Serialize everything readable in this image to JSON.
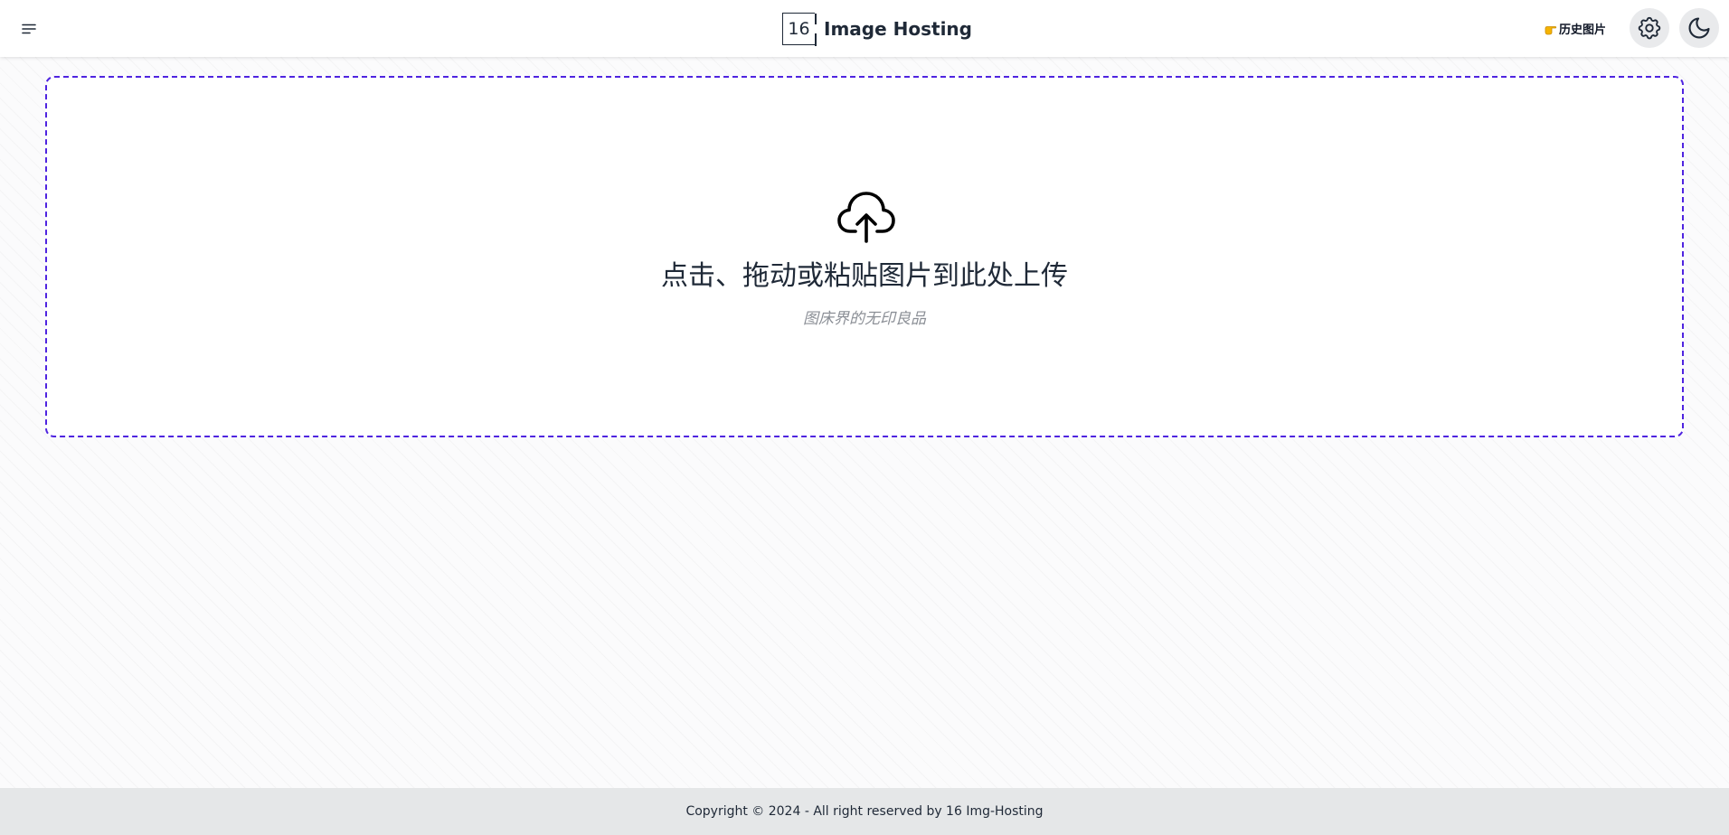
{
  "header": {
    "logo_text": "16",
    "brand": "Image Hosting",
    "history_link": "历史图片",
    "icons": {
      "menu": "menu-icon",
      "history": "pointing-hand-icon",
      "settings": "gear-icon",
      "theme": "moon-icon"
    }
  },
  "upload": {
    "title": "点击、拖动或粘贴图片到此处上传",
    "subtitle": "图床界的无印良品",
    "icon": "cloud-upload-icon",
    "border_color": "#4f24e0"
  },
  "footer": {
    "text": "Copyright © 2024 - All right reserved by 16 Img-Hosting"
  }
}
